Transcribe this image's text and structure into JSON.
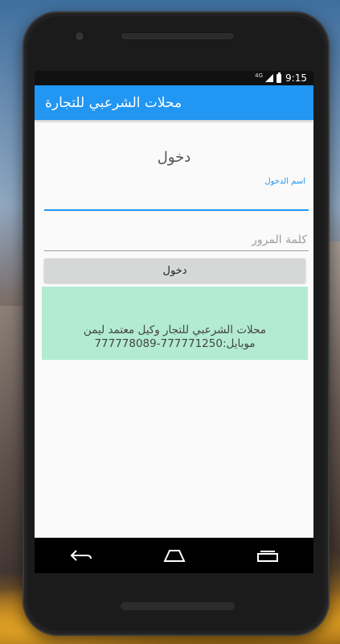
{
  "status_bar": {
    "network_label": "4G",
    "time": "9:15"
  },
  "app": {
    "title": "محلات الشرعبي للتجارة"
  },
  "login_form": {
    "title": "دخول",
    "username_label": "اسم الدخول",
    "username_value": "",
    "password_placeholder": "كلمة المرور",
    "login_button_label": "دخول"
  },
  "info_box": {
    "line1": "محلات الشرعبي للتجار وكيل معتمد ليمن",
    "line2": "موبايل:777771250-777778089"
  },
  "colors": {
    "primary": "#2196f3",
    "info_background": "#b2ebd2",
    "button_background": "#d6d7d7"
  },
  "nav_bar": {
    "icons": [
      "back-icon",
      "home-icon",
      "recents-icon"
    ]
  }
}
